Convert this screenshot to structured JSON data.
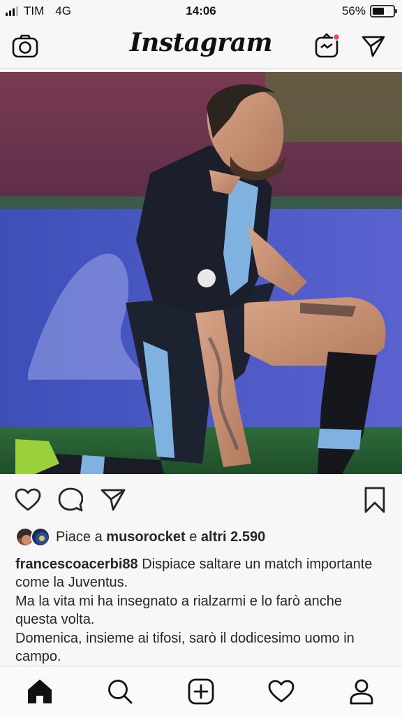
{
  "status_bar": {
    "carrier": "TIM",
    "network": "4G",
    "time": "14:06",
    "battery_percent": "56%",
    "battery_level": 0.56
  },
  "header": {
    "logo_text": "Instagram",
    "icons": [
      "camera-icon",
      "igtv-icon",
      "direct-message-icon"
    ],
    "igtv_badge_color": "#ed4956"
  },
  "post": {
    "image_alt": "",
    "likes": {
      "prefix": "Piace a",
      "user": "musorocket",
      "connector": "e",
      "others": "altri 2.590"
    },
    "caption": {
      "username": "francescoacerbi88",
      "line1": "Dispiace saltare un match importante come la Juventus.",
      "line2": "Ma la vita mi ha insegnato a rialzarmi e lo farò anche questa volta.",
      "line3": "Domenica, insieme ai tifosi, sarò il dodicesimo uomo in campo."
    },
    "action_icons": [
      "heart-icon",
      "comment-icon",
      "share-icon",
      "bookmark-icon"
    ]
  },
  "bottom_nav": {
    "tabs": [
      "home-icon",
      "search-icon",
      "new-post-icon",
      "activity-icon",
      "profile-icon"
    ]
  },
  "colors": {
    "text": "#262626",
    "divider": "#dbdbdb",
    "background": "#f7f7f7"
  }
}
